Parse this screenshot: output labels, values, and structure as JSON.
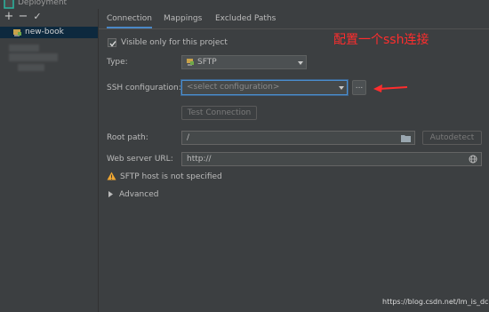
{
  "window": {
    "title": "Deployment"
  },
  "sidebar": {
    "toolbar": {
      "add_label": "+",
      "remove_label": "−",
      "apply_label": "✓"
    },
    "server_name": "new-book"
  },
  "tabs": [
    "Connection",
    "Mappings",
    "Excluded Paths"
  ],
  "connection": {
    "visible_only_label": "Visible only for this project",
    "visible_only_checked": true,
    "type_label": "Type:",
    "type_value": "SFTP",
    "ssh_label": "SSH configuration:",
    "ssh_placeholder": "<select configuration>",
    "ssh_more_label": "...",
    "test_button": "Test Connection",
    "root_path_label": "Root path:",
    "root_path_value": "/",
    "autodetect_button": "Autodetect",
    "web_url_label": "Web server URL:",
    "web_url_value": "http://",
    "warning_text": "SFTP host is not specified",
    "advanced_label": "Advanced"
  },
  "annotation": {
    "text": "配置一个ssh连接"
  },
  "watermark": "https://blog.csdn.net/lm_is_dc",
  "colors": {
    "accent": "#4a88c7",
    "annotation": "#ff2d2d",
    "warning": "#f0a732"
  }
}
